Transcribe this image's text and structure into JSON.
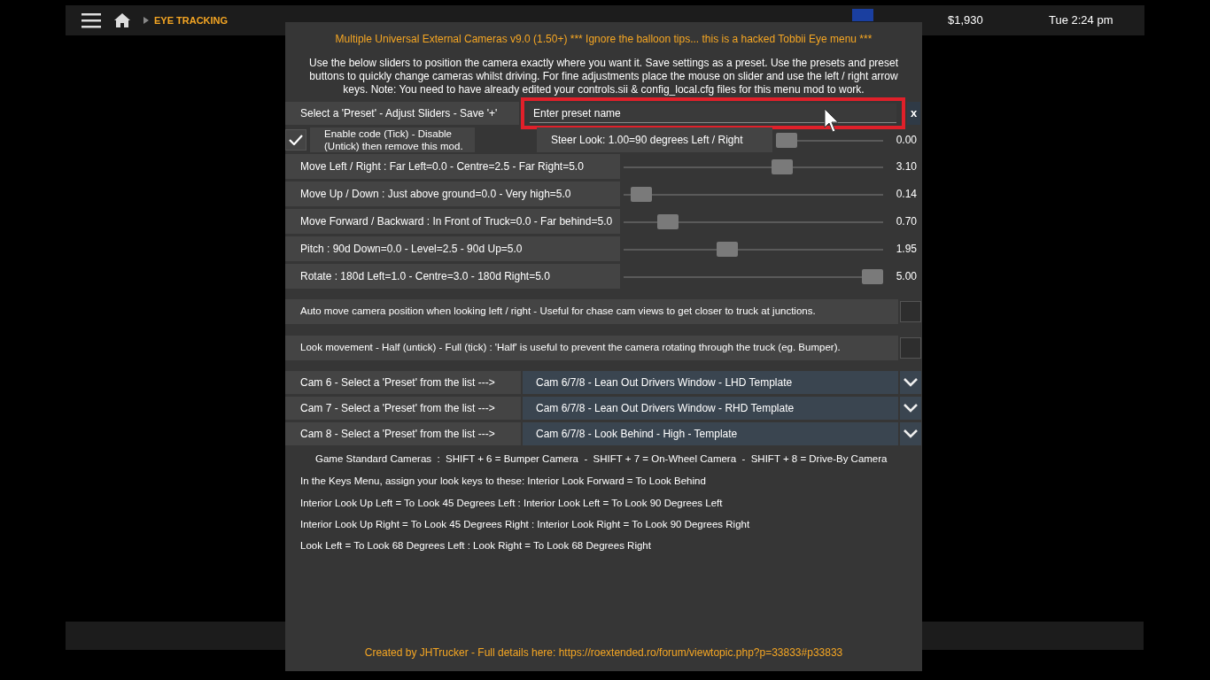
{
  "top_bar": {
    "breadcrumb": "EYE TRACKING",
    "money": "$1,930",
    "clock": "Tue 2:24 pm"
  },
  "dialog": {
    "title": "Multiple Universal External Cameras v9.0 (1.50+) *** Ignore the balloon tips... this is a hacked Tobbii Eye menu ***",
    "intro": "Use the below sliders to position the camera exactly where you want it. Save settings as a preset. Use the presets and preset buttons to quickly change cameras whilst driving. For fine adjustments place the mouse on slider and use the left / right arrow keys. Note: You need to have already edited your controls.sii & config_local.cfg files for this menu mod to work.",
    "preset": {
      "label": "Select a 'Preset' - Adjust Sliders - Save '+'",
      "placeholder": "Enter preset name",
      "highlighted": true,
      "clear": "x"
    },
    "enable": {
      "label": "Enable code (Tick) - Disable (Untick) then remove this mod.",
      "checked": true
    },
    "steer": {
      "label": "Steer Look: 1.00=90 degrees Left / Right",
      "level": 0,
      "reading": "0.00"
    },
    "sliders": [
      {
        "label": "Move Left / Right : Far Left=0.0 - Centre=2.5 - Far Right=5.0",
        "level": 0.62,
        "reading": "3.10"
      },
      {
        "label": "Move Up / Down : Just above ground=0.0 - Very high=5.0",
        "level": 0.028,
        "reading": "0.14"
      },
      {
        "label": "Move Forward / Backward : In Front of Truck=0.0 - Far behind=5.0",
        "level": 0.14,
        "reading": "0.70"
      },
      {
        "label": "Pitch : 90d Down=0.0 - Level=2.5 - 90d Up=5.0",
        "level": 0.39,
        "reading": "1.95"
      },
      {
        "label": "Rotate : 180d Left=1.0 - Centre=3.0 - 180d Right=5.0",
        "level": 1,
        "reading": "5.00"
      }
    ],
    "toggles": [
      {
        "label": "Auto move camera position when looking left / right - Useful for chase cam views to get closer to truck at junctions.",
        "checked": false
      },
      {
        "label": "Look movement - Half (untick) - Full (tick) : 'Half' is useful to prevent the camera rotating through the truck (eg. Bumper).",
        "checked": false
      }
    ],
    "cams": [
      {
        "label": "Cam 6 - Select a 'Preset' from the list --->",
        "value": "Cam 6/7/8 - Lean Out Drivers Window - LHD Template"
      },
      {
        "label": "Cam 7 - Select a 'Preset' from the list --->",
        "value": "Cam 6/7/8 - Lean Out Drivers Window - RHD Template"
      },
      {
        "label": "Cam 8 - Select a 'Preset' from the list --->",
        "value": "Cam 6/7/8 - Look Behind - High - Template"
      }
    ],
    "standard": "Game Standard Cameras  :  SHIFT + 6 = Bumper Camera  -  SHIFT + 7 = On-Wheel Camera  -  SHIFT + 8 = Drive-By Camera",
    "notes": [
      "In the Keys Menu, assign your look keys to these: Interior Look Forward = To Look Behind",
      "Interior Look Up Left = To Look 45 Degrees Left : Interior Look Left = To Look 90 Degrees Left",
      "Interior Look Up Right = To Look 45 Degrees Right : Interior Look Right = To Look 90 Degrees Right",
      "Look Left = To Look 68 Degrees Left : Look Right = To Look 68 Degrees Right"
    ],
    "footer": "Created by JHTrucker - Full details here: https://roextended.ro/forum/viewtopic.php?p=33833#p33833"
  }
}
